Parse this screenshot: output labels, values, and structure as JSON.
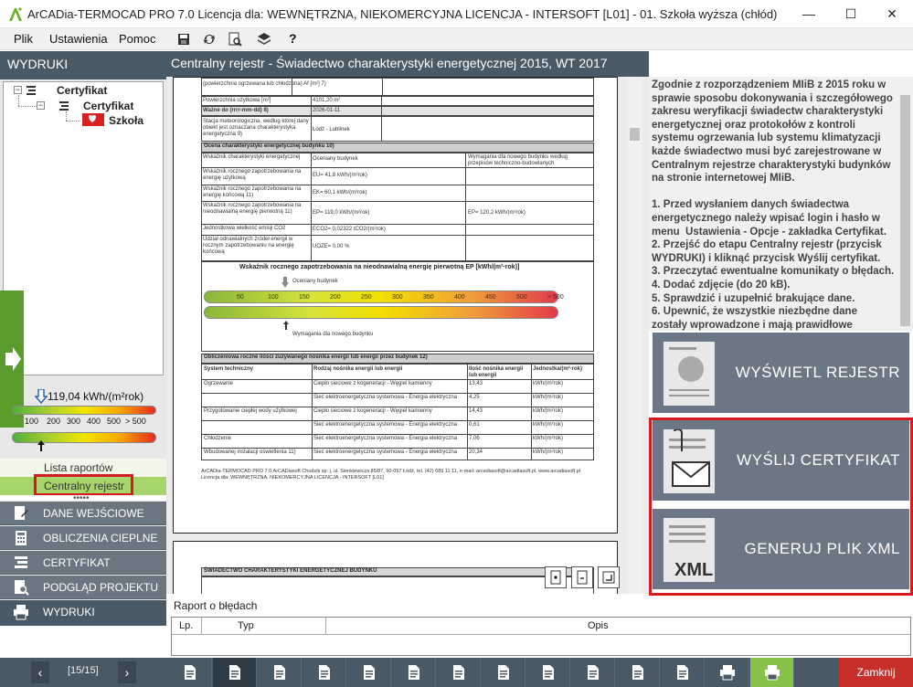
{
  "window": {
    "title": "ArCADia-TERMOCAD PRO 7.0 Licencja dla: WEWNĘTRZNA, NIEKOMERCYJNA LICENCJA - INTERSOFT [L01] - 01. Szkoła wyższa (chłód)",
    "minimize": "—",
    "maximize": "☐",
    "close": "✕"
  },
  "menu": {
    "plik": "Plik",
    "ustawienia": "Ustawienia",
    "pomoc": "Pomoc"
  },
  "left": {
    "header": "WYDRUKI",
    "tree": {
      "root": "Certyfikat",
      "child": "Certyfikat",
      "leaf": "Szkoła"
    },
    "indicator_value": "119,04 kWh/(m²rok)",
    "gauge_ticks": [
      "100",
      "200",
      "300",
      "400",
      "500",
      "> 500"
    ],
    "sub_items": [
      "Lista raportów",
      "Centralny rejestr"
    ],
    "nav": [
      "DANE WEJŚCIOWE",
      "OBLICZENIA CIEPLNE",
      "CERTYFIKAT",
      "PODGLĄD PROJEKTU",
      "WYDRUKI"
    ],
    "pager": {
      "label": "[15/15]",
      "prev": "‹",
      "next": "›"
    }
  },
  "center": {
    "header": "Centralny rejestr - Świadectwo charakterystyki energetycznej 2015, WT 2017",
    "doc": {
      "r1": "(powierzchnia ogrzewana lub chłodzona) Af [m²] 7)",
      "r2": "Powierzchnia użytkowa [m²]",
      "r2v": "4101,20 m²",
      "r3": "Ważne do (rrrr-mm-dd) 8)",
      "r3v": "2026-01-11",
      "r4": "Stacja meteorologiczna, według której dany obiekt jest oznaczana charakterystyka energetyczna 9)",
      "r4v": "Łódź - Lublinek",
      "sec1": "Ocena charakterystyki energetycznej budynku 10)",
      "colA": "Wskaźnik charakterystyki energetycznej",
      "colB": "Oceniany budynek",
      "colC": "Wymagania dla nowego budynku według przepisów techniczno-budowlanych",
      "w1": "Wskaźnik rocznego zapotrzebowania na energię użytkową",
      "w1v": "EU= 41,8 kWh/(m²rok)",
      "w2": "Wskaźnik rocznego zapotrzebowania na energię końcową 11)",
      "w2v": "EK= 60,1 kWh/(m²rok)",
      "w3": "Wskaźnik rocznego zapotrzebowania na nieodnawialną energię pierwotną 11)",
      "w3v": "EP= 119,0 kWh/(m²rok)",
      "w3c": "EP= 120,2 kWh/(m²rok)",
      "w4": "Jednostkowa wielkość emisji CO2",
      "w4v": "ECO2= 0,02322 tCO2/(m²rok)",
      "w5": "Udział odnawialnych źródeł energii w rocznym zapotrzebowaniu na energię końcową",
      "w5v": "UOZE= 0,00 %",
      "scale_title": "Wskaźnik rocznego zapotrzebowania na nieodnawialną energię pierwotną EP [kWh/(m²·rok)]",
      "scale_top": "Oceniany budynek",
      "scale_bottom": "Wymagania dla nowego budynku",
      "scale_ticks": [
        "50",
        "100",
        "150",
        "200",
        "250",
        "300",
        "350",
        "400",
        "450",
        "500",
        "> 500"
      ],
      "sec2": "Obliczeniowa roczne ilości zużywanego nośnika energii lub energii przez budynek 12)",
      "t2h": [
        "System techniczny",
        "Rodzaj nośnika energii lub energii",
        "Ilość nośnika energii lub energii",
        "Jednostka/(m²·rok)"
      ],
      "t2rows": [
        [
          "Ogrzewanie",
          "Ciepło sieciowe z kogeneracji - Węgiel kamienny",
          "13,43",
          "kWh/(m²rok)"
        ],
        [
          "",
          "Sieć elektroenergetyczna systemowa - Energia elektryczna",
          "4,25",
          "kWh/(m²rok)"
        ],
        [
          "Przygotowanie ciepłej wody użytkowej",
          "Ciepło sieciowe z kogeneracji - Węgiel kamienny",
          "14,43",
          "kWh/(m²rok)"
        ],
        [
          "",
          "Sieć elektroenergetyczna systemowa - Energia elektryczna",
          "0,61",
          "kWh/(m²rok)"
        ],
        [
          "Chłodzenie",
          "Sieć elektroenergetyczna systemowa - Energia elektryczna",
          "7,06",
          "kWh/(m²rok)"
        ],
        [
          "Wbudowanej instalacji oświetlenia 11)",
          "Sieć elektroenergetyczna systemowa - Energia elektryczna",
          "20,34",
          "kWh/(m²rok)"
        ]
      ],
      "footer1": "ArCADia-TERMOCAD PRO 7.0 ArCADiasoft Chudzik sp. j. ul. Sienkiewicza 85/87, 90-057 Łódź, tel. (42) 689 11 11, e-mail: arcadiasoft@arcadiasoft.pl, www.arcadiasoft.pl",
      "footer2": "Licencja dla: WEWNĘTRZNA, NIEKOMERCYJNA LICENCJA - INTERSOFT [L01]",
      "page2_header": "ŚWIADECTWO CHARAKTERYSTYKI ENERGETYCZNEJ BUDYNKU"
    },
    "error_title": "Raport o błędach",
    "error_cols": [
      "Lp.",
      "Typ",
      "Opis"
    ]
  },
  "right": {
    "info": "Zgodnie z rozporządzeniem MIiB z 2015 roku w sprawie sposobu dokonywania i szczegółowego zakresu weryfikacji świadectw charakterystyki energetycznej oraz protokołów z kontroli systemu ogrzewania lub systemu klimatyzacji każde świadectwo musi być zarejestrowane w Centralnym rejestrze charakterystyki budynków na stronie internetowej MIiB.\n\n1. Przed wysłaniem danych świadectwa energetycznego należy wpisać login i hasło w menu  Ustawienia - Opcje - zakładka Certyfikat.\n2. Przejść do etapu Centralny rejestr (przycisk WYDRUKI) i kliknąć przycisk Wyślij certyfikat.\n3. Przeczytać ewentualne komunikaty o błędach.\n4. Dodać zdjęcie (do 20 kB).\n5. Sprawdzić i uzupełnić brakujące dane.\n6. Upewnić, że wszystkie niezbędne dane zostały wprowadzone i mają prawidłowe",
    "btn_show": "WYŚWIETL REJESTR",
    "btn_send": "WYŚLIJ CERTYFIKAT",
    "btn_xml": "GENERUJ PLIK XML",
    "xml_label": "XML"
  },
  "bottom": {
    "close": "Zamknij"
  },
  "colors": {
    "header_bg": "#4a5966",
    "nav_bg": "#6a7783",
    "accent_green": "#86c24a",
    "close_red": "#c62f2a",
    "highlight_red": "#d71920"
  }
}
